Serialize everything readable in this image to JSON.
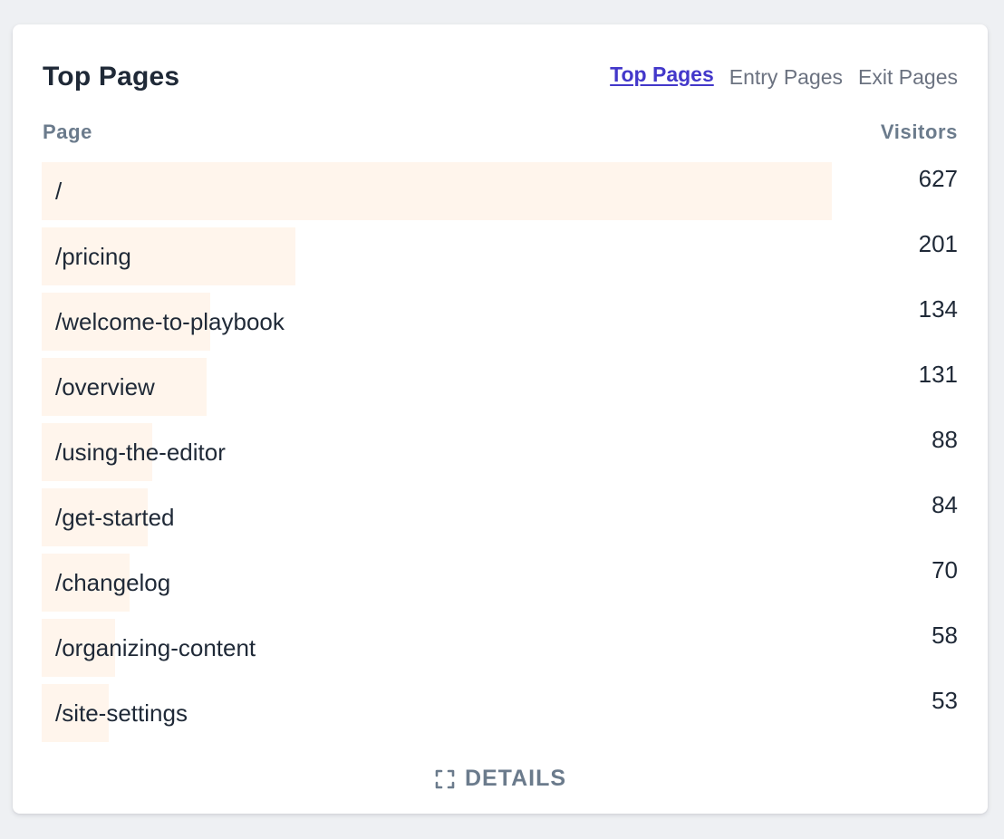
{
  "card": {
    "title": "Top Pages",
    "tabs": [
      {
        "label": "Top Pages",
        "active": true
      },
      {
        "label": "Entry Pages",
        "active": false
      },
      {
        "label": "Exit Pages",
        "active": false
      }
    ]
  },
  "columns": {
    "page": "Page",
    "visitors": "Visitors"
  },
  "rows": [
    {
      "page": "/",
      "visitors": 627
    },
    {
      "page": "/pricing",
      "visitors": 201
    },
    {
      "page": "/welcome-to-playbook",
      "visitors": 134
    },
    {
      "page": "/overview",
      "visitors": 131
    },
    {
      "page": "/using-the-editor",
      "visitors": 88
    },
    {
      "page": "/get-started",
      "visitors": 84
    },
    {
      "page": "/changelog",
      "visitors": 70
    },
    {
      "page": "/organizing-content",
      "visitors": 58
    },
    {
      "page": "/site-settings",
      "visitors": 53
    }
  ],
  "footer": {
    "details_label": "DETAILS",
    "details_icon": "expand-icon"
  },
  "colors": {
    "bar": "#fff5ec",
    "active_tab": "#4338ca",
    "text": "#1f2937",
    "muted": "#6b7b8c"
  }
}
